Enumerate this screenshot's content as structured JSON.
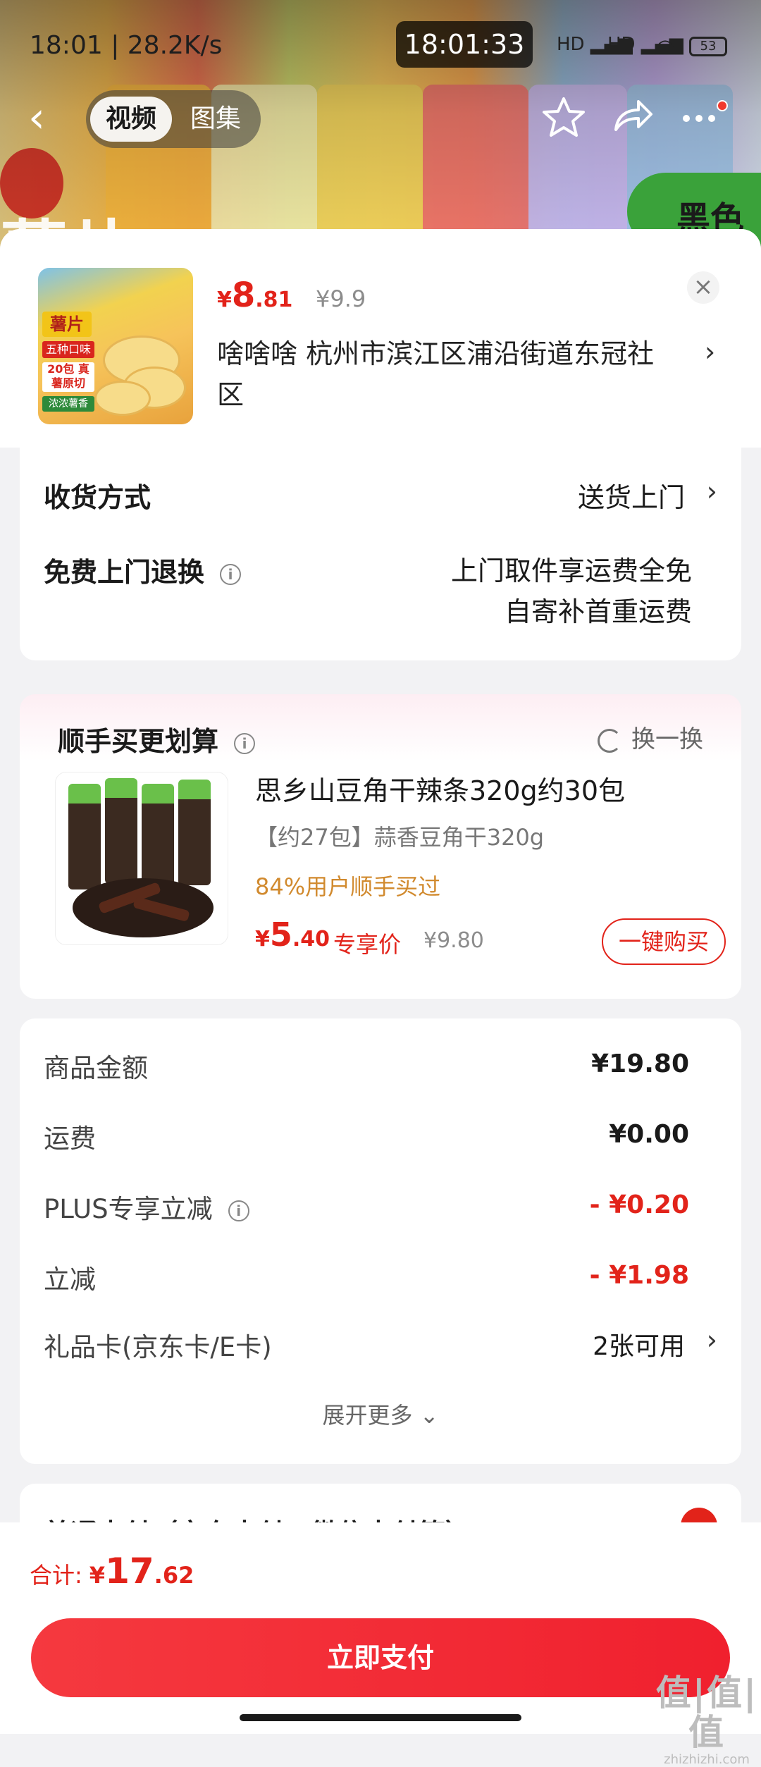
{
  "status_bar": {
    "left_text": "18:01 | 28.2K/s",
    "time": "18:01:33",
    "signal1": "HD",
    "signal2": "HD",
    "battery": "53"
  },
  "nav": {
    "tabs": [
      {
        "label": "视频",
        "active": true
      },
      {
        "label": "图集",
        "active": false
      }
    ],
    "icons": [
      "back-arrow-icon",
      "star-icon",
      "share-icon",
      "more-icon"
    ]
  },
  "hero": {
    "big_text": "薯片",
    "badge_text": "黑色"
  },
  "product": {
    "thumb_tags": [
      "薯片",
      "五种口味",
      "20包 真薯原切",
      "浓浓薯香"
    ],
    "price_yen": "¥",
    "price_int": "8",
    "price_dec": ".81",
    "price_original": "¥9.9",
    "address": "啥啥啥  杭州市滨江区浦沿街道东冠社区"
  },
  "delivery": {
    "method_label": "收货方式",
    "method_value": "送货上门",
    "return_label": "免费上门退换",
    "return_value_line1": "上门取件享运费全免",
    "return_value_line2": "自寄补首重运费"
  },
  "bundle": {
    "title": "顺手买更划算",
    "swap_label": "换一换",
    "item_name": "思乡山豆角干辣条320g约30包",
    "item_spec": "【约27包】蒜香豆角干320g",
    "item_hint": "84%用户顺手买过",
    "price_yen": "¥",
    "price_int": "5",
    "price_dec": ".40",
    "price_tag": "专享价",
    "price_original": "¥9.80",
    "buy_label": "一键购买"
  },
  "amounts": {
    "rows": [
      {
        "label": "商品金额",
        "value": "¥19.80"
      },
      {
        "label": "运费",
        "value": "¥0.00"
      },
      {
        "label": "PLUS专享立减",
        "value": "- ¥0.20"
      },
      {
        "label": "立减",
        "value": "- ¥1.98"
      },
      {
        "label": "礼品卡(京东卡/E卡)",
        "value": "2张可用"
      }
    ],
    "expand_label": "展开更多"
  },
  "payment": {
    "method_label": "普通支付（京东支付、微信支付等）"
  },
  "footer": {
    "total_label": "合计:",
    "total_yen": "¥",
    "total_int": "17",
    "total_dec": ".62",
    "pay_button": "立即支付"
  },
  "watermark": {
    "big": "值|值|值",
    "small": "zhizhizhi.com"
  },
  "colors": {
    "accent_red": "#e2231a",
    "hint_orange": "#d18a2e",
    "muted_gray": "#8c8c8c"
  }
}
